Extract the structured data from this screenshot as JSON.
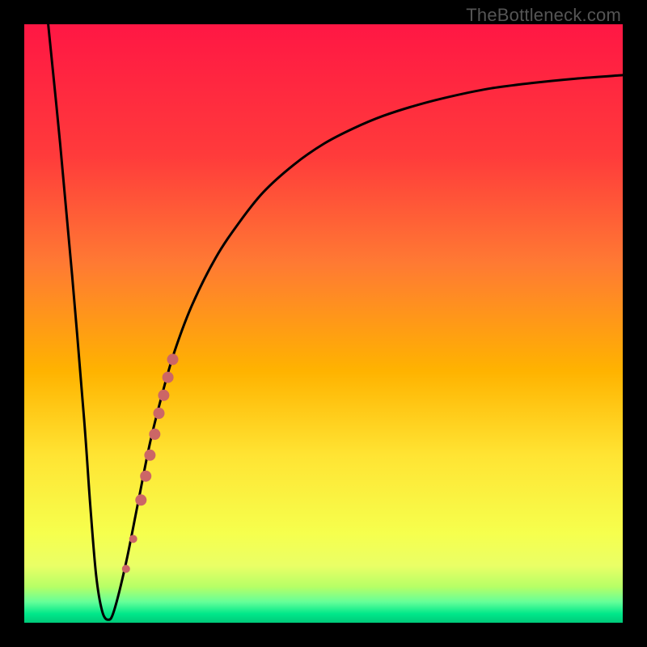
{
  "watermark": {
    "text": "TheBottleneck.com"
  },
  "colors": {
    "frame": "#000000",
    "curve": "#000000",
    "scatter": "#cc6666",
    "gradient_stops": [
      {
        "offset": 0.0,
        "color": "#ff1744"
      },
      {
        "offset": 0.22,
        "color": "#ff3b3b"
      },
      {
        "offset": 0.4,
        "color": "#ff7a33"
      },
      {
        "offset": 0.58,
        "color": "#ffb300"
      },
      {
        "offset": 0.72,
        "color": "#ffe433"
      },
      {
        "offset": 0.85,
        "color": "#f6ff4d"
      },
      {
        "offset": 0.905,
        "color": "#eaff66"
      },
      {
        "offset": 0.94,
        "color": "#b6ff66"
      },
      {
        "offset": 0.965,
        "color": "#66ff99"
      },
      {
        "offset": 0.985,
        "color": "#00e88a"
      },
      {
        "offset": 1.0,
        "color": "#00c97a"
      }
    ]
  },
  "chart_data": {
    "type": "line",
    "title": "",
    "xlabel": "",
    "ylabel": "",
    "xlim": [
      0,
      100
    ],
    "ylim": [
      0,
      100
    ],
    "grid": false,
    "legend": false,
    "series": [
      {
        "name": "bottleneck-curve",
        "x": [
          4,
          6,
          8,
          10,
          11,
          12,
          13,
          14,
          15,
          17,
          19,
          21,
          23,
          25,
          28,
          32,
          36,
          40,
          45,
          50,
          55,
          60,
          66,
          72,
          78,
          85,
          92,
          100
        ],
        "y": [
          100,
          80,
          58,
          34,
          20,
          8,
          2,
          0.5,
          2,
          10,
          20,
          30,
          38,
          45,
          53,
          61,
          67,
          72,
          76.5,
          80,
          82.6,
          84.7,
          86.6,
          88.1,
          89.3,
          90.2,
          90.9,
          91.5
        ]
      }
    ],
    "scatter": {
      "name": "highlight-points",
      "points": [
        {
          "x": 17.0,
          "y": 9.0,
          "r": 5
        },
        {
          "x": 18.2,
          "y": 14.0,
          "r": 5
        },
        {
          "x": 19.5,
          "y": 20.5,
          "r": 7
        },
        {
          "x": 20.3,
          "y": 24.5,
          "r": 7
        },
        {
          "x": 21.0,
          "y": 28.0,
          "r": 7
        },
        {
          "x": 21.8,
          "y": 31.5,
          "r": 7
        },
        {
          "x": 22.5,
          "y": 35.0,
          "r": 7
        },
        {
          "x": 23.3,
          "y": 38.0,
          "r": 7
        },
        {
          "x": 24.0,
          "y": 41.0,
          "r": 7
        },
        {
          "x": 24.8,
          "y": 44.0,
          "r": 7
        }
      ]
    }
  }
}
